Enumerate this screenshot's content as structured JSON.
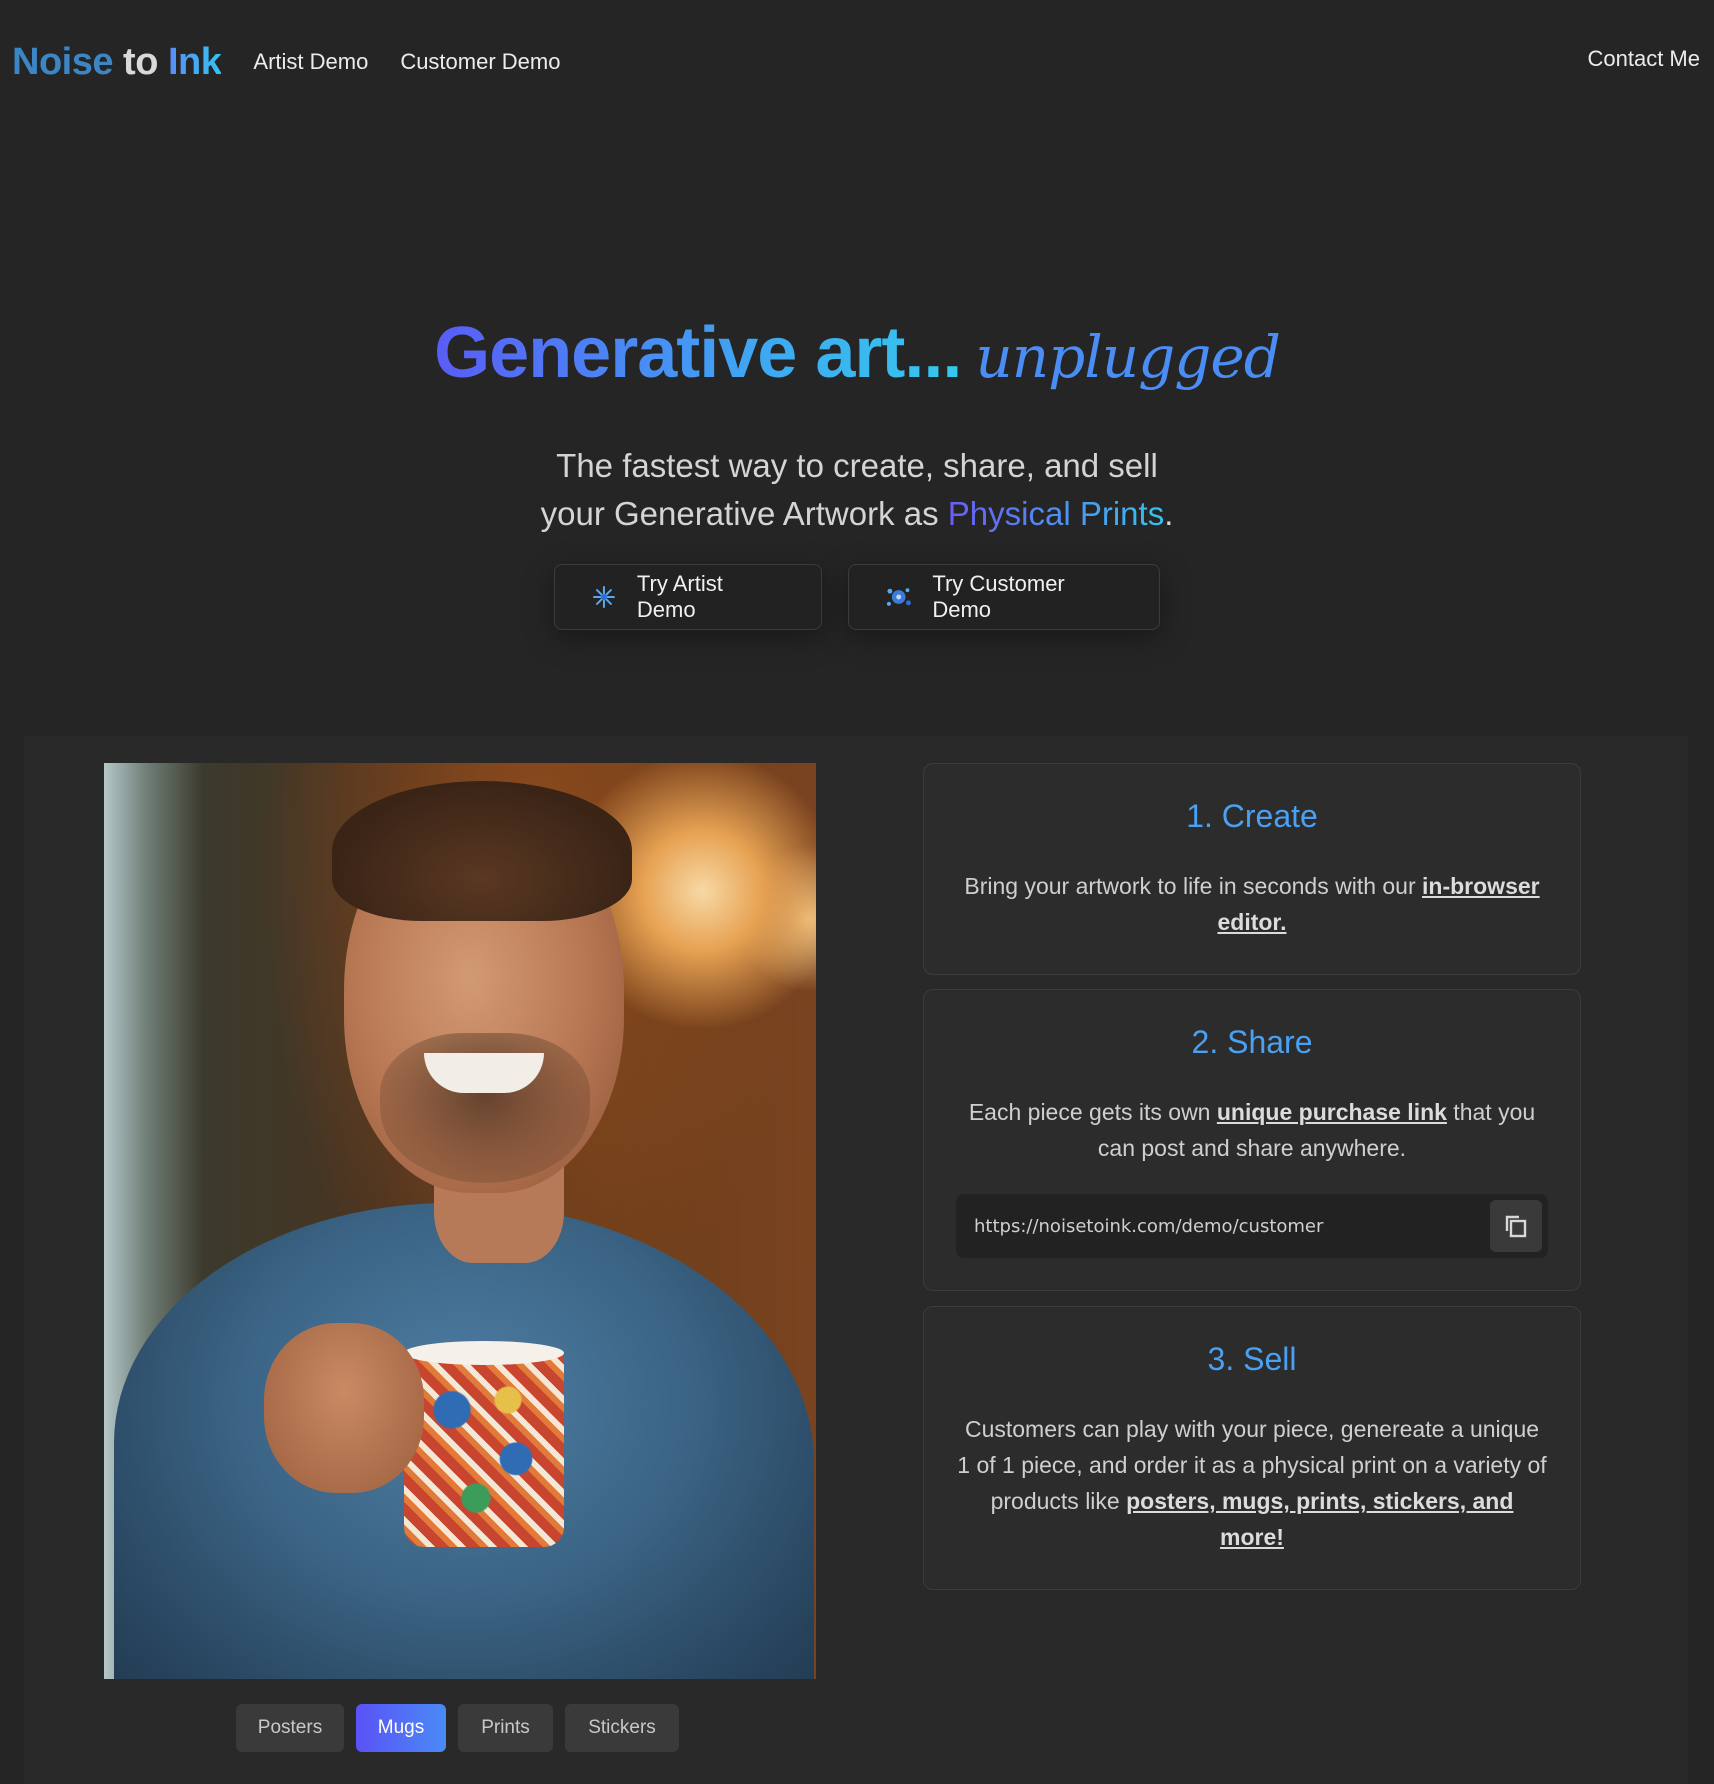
{
  "nav": {
    "logo_word1": "Noise",
    "logo_word2": "to",
    "logo_word3": "Ink",
    "links": [
      "Artist Demo",
      "Customer Demo"
    ],
    "contact": "Contact Me"
  },
  "hero": {
    "title_main": "Generative art...",
    "title_script": "unplugged",
    "subtitle_line1": "The fastest way to create, share, and sell",
    "subtitle_line2_start": "your Generative Artwork as ",
    "subtitle_highlight": "Physical Prints",
    "subtitle_end": ".",
    "cta_artist": "Try Artist Demo",
    "cta_customer": "Try Customer Demo"
  },
  "product_tabs": {
    "items": [
      "Posters",
      "Mugs",
      "Prints",
      "Stickers"
    ],
    "selected": "Mugs"
  },
  "steps": {
    "create": {
      "title": "1. Create",
      "text_start": "Bring your artwork to life in seconds with our ",
      "link": "in-browser editor."
    },
    "share": {
      "title": "2. Share",
      "text_start": "Each piece gets its own ",
      "link": "unique purchase link",
      "text_end": " that you can post and share anywhere.",
      "url": "https://noisetoink.com/demo/customer"
    },
    "sell": {
      "title": "3. Sell",
      "text_start": "Customers can play with your piece, genereate a unique 1 of 1 piece, and order it as a physical print on a variety of products like ",
      "link": "posters, mugs, prints, stickers, and more!"
    }
  },
  "colors": {
    "background": "#252525",
    "accent_blue": "#4aa0f2",
    "accent_purple": "#5a52f6"
  },
  "icons": {
    "cta_artist": "sparkle-splash-icon",
    "cta_customer": "paint-splash-icon",
    "copy": "copy-icon"
  }
}
